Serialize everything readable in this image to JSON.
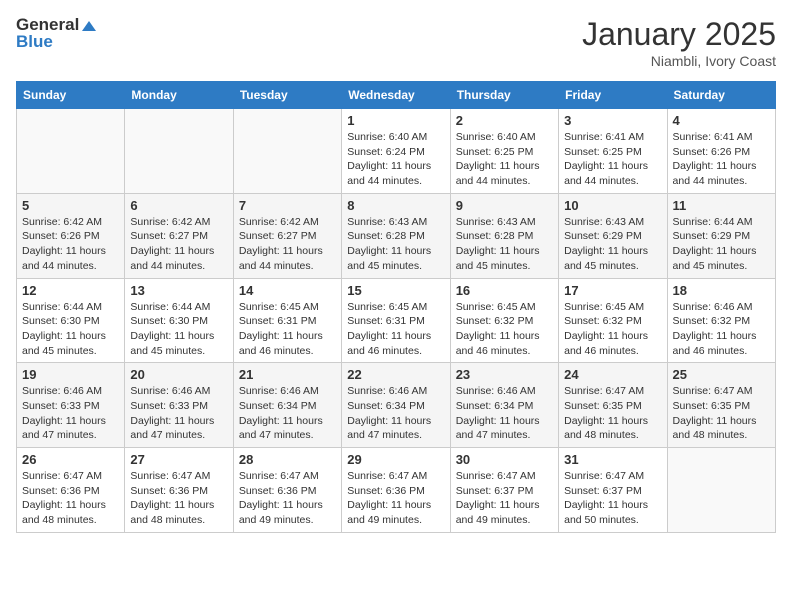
{
  "logo": {
    "line1": "General",
    "line2": "Blue"
  },
  "title": "January 2025",
  "subtitle": "Niambli, Ivory Coast",
  "days_of_week": [
    "Sunday",
    "Monday",
    "Tuesday",
    "Wednesday",
    "Thursday",
    "Friday",
    "Saturday"
  ],
  "weeks": [
    [
      {
        "day": "",
        "info": ""
      },
      {
        "day": "",
        "info": ""
      },
      {
        "day": "",
        "info": ""
      },
      {
        "day": "1",
        "info": "Sunrise: 6:40 AM\nSunset: 6:24 PM\nDaylight: 11 hours and 44 minutes."
      },
      {
        "day": "2",
        "info": "Sunrise: 6:40 AM\nSunset: 6:25 PM\nDaylight: 11 hours and 44 minutes."
      },
      {
        "day": "3",
        "info": "Sunrise: 6:41 AM\nSunset: 6:25 PM\nDaylight: 11 hours and 44 minutes."
      },
      {
        "day": "4",
        "info": "Sunrise: 6:41 AM\nSunset: 6:26 PM\nDaylight: 11 hours and 44 minutes."
      }
    ],
    [
      {
        "day": "5",
        "info": "Sunrise: 6:42 AM\nSunset: 6:26 PM\nDaylight: 11 hours and 44 minutes."
      },
      {
        "day": "6",
        "info": "Sunrise: 6:42 AM\nSunset: 6:27 PM\nDaylight: 11 hours and 44 minutes."
      },
      {
        "day": "7",
        "info": "Sunrise: 6:42 AM\nSunset: 6:27 PM\nDaylight: 11 hours and 44 minutes."
      },
      {
        "day": "8",
        "info": "Sunrise: 6:43 AM\nSunset: 6:28 PM\nDaylight: 11 hours and 45 minutes."
      },
      {
        "day": "9",
        "info": "Sunrise: 6:43 AM\nSunset: 6:28 PM\nDaylight: 11 hours and 45 minutes."
      },
      {
        "day": "10",
        "info": "Sunrise: 6:43 AM\nSunset: 6:29 PM\nDaylight: 11 hours and 45 minutes."
      },
      {
        "day": "11",
        "info": "Sunrise: 6:44 AM\nSunset: 6:29 PM\nDaylight: 11 hours and 45 minutes."
      }
    ],
    [
      {
        "day": "12",
        "info": "Sunrise: 6:44 AM\nSunset: 6:30 PM\nDaylight: 11 hours and 45 minutes."
      },
      {
        "day": "13",
        "info": "Sunrise: 6:44 AM\nSunset: 6:30 PM\nDaylight: 11 hours and 45 minutes."
      },
      {
        "day": "14",
        "info": "Sunrise: 6:45 AM\nSunset: 6:31 PM\nDaylight: 11 hours and 46 minutes."
      },
      {
        "day": "15",
        "info": "Sunrise: 6:45 AM\nSunset: 6:31 PM\nDaylight: 11 hours and 46 minutes."
      },
      {
        "day": "16",
        "info": "Sunrise: 6:45 AM\nSunset: 6:32 PM\nDaylight: 11 hours and 46 minutes."
      },
      {
        "day": "17",
        "info": "Sunrise: 6:45 AM\nSunset: 6:32 PM\nDaylight: 11 hours and 46 minutes."
      },
      {
        "day": "18",
        "info": "Sunrise: 6:46 AM\nSunset: 6:32 PM\nDaylight: 11 hours and 46 minutes."
      }
    ],
    [
      {
        "day": "19",
        "info": "Sunrise: 6:46 AM\nSunset: 6:33 PM\nDaylight: 11 hours and 47 minutes."
      },
      {
        "day": "20",
        "info": "Sunrise: 6:46 AM\nSunset: 6:33 PM\nDaylight: 11 hours and 47 minutes."
      },
      {
        "day": "21",
        "info": "Sunrise: 6:46 AM\nSunset: 6:34 PM\nDaylight: 11 hours and 47 minutes."
      },
      {
        "day": "22",
        "info": "Sunrise: 6:46 AM\nSunset: 6:34 PM\nDaylight: 11 hours and 47 minutes."
      },
      {
        "day": "23",
        "info": "Sunrise: 6:46 AM\nSunset: 6:34 PM\nDaylight: 11 hours and 47 minutes."
      },
      {
        "day": "24",
        "info": "Sunrise: 6:47 AM\nSunset: 6:35 PM\nDaylight: 11 hours and 48 minutes."
      },
      {
        "day": "25",
        "info": "Sunrise: 6:47 AM\nSunset: 6:35 PM\nDaylight: 11 hours and 48 minutes."
      }
    ],
    [
      {
        "day": "26",
        "info": "Sunrise: 6:47 AM\nSunset: 6:36 PM\nDaylight: 11 hours and 48 minutes."
      },
      {
        "day": "27",
        "info": "Sunrise: 6:47 AM\nSunset: 6:36 PM\nDaylight: 11 hours and 48 minutes."
      },
      {
        "day": "28",
        "info": "Sunrise: 6:47 AM\nSunset: 6:36 PM\nDaylight: 11 hours and 49 minutes."
      },
      {
        "day": "29",
        "info": "Sunrise: 6:47 AM\nSunset: 6:36 PM\nDaylight: 11 hours and 49 minutes."
      },
      {
        "day": "30",
        "info": "Sunrise: 6:47 AM\nSunset: 6:37 PM\nDaylight: 11 hours and 49 minutes."
      },
      {
        "day": "31",
        "info": "Sunrise: 6:47 AM\nSunset: 6:37 PM\nDaylight: 11 hours and 50 minutes."
      },
      {
        "day": "",
        "info": ""
      }
    ]
  ]
}
